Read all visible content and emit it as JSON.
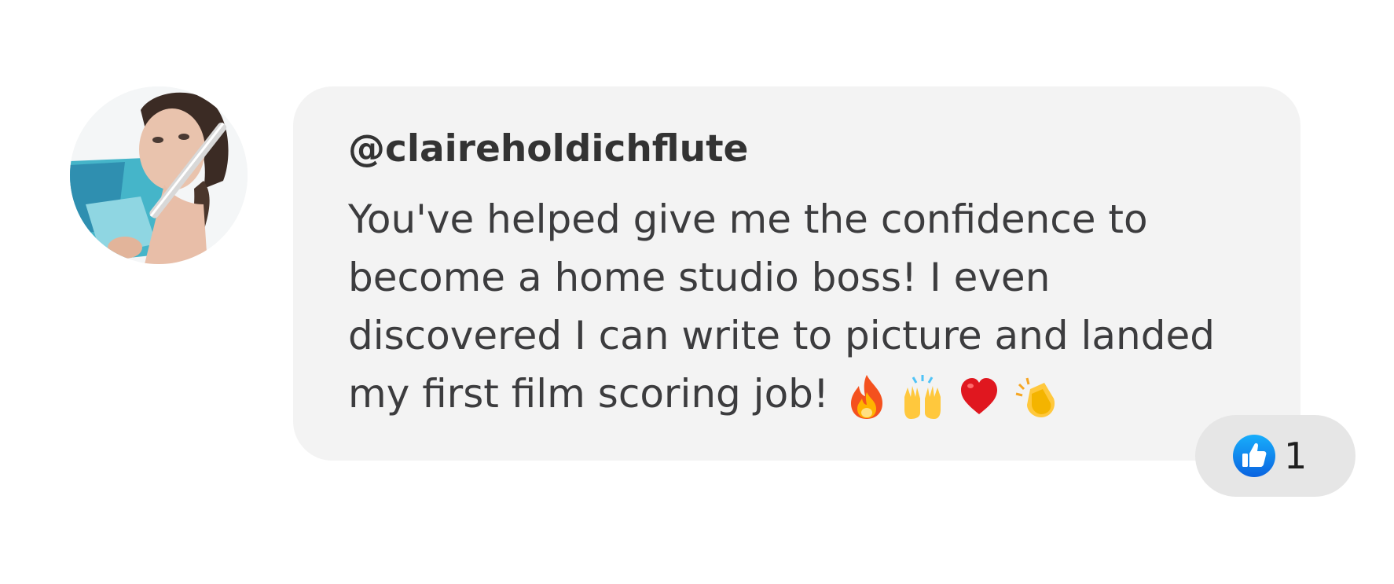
{
  "comment": {
    "username": "@claireholdichflute",
    "text": "You've helped give me the confidence to become a home studio boss! I even discovered I can write to picture and landed my first film scoring job!",
    "emojis": [
      "fire-emoji",
      "raising-hands-emoji",
      "red-heart-emoji",
      "clapping-hands-emoji"
    ]
  },
  "avatar": {
    "icon": "profile-photo"
  },
  "reaction": {
    "icon": "thumbs-up-icon",
    "count": "1",
    "color": "#1877f2"
  },
  "colors": {
    "bubble_background": "#f3f3f3",
    "reaction_background": "#e6e6e6",
    "text": "#3c3c3e"
  }
}
